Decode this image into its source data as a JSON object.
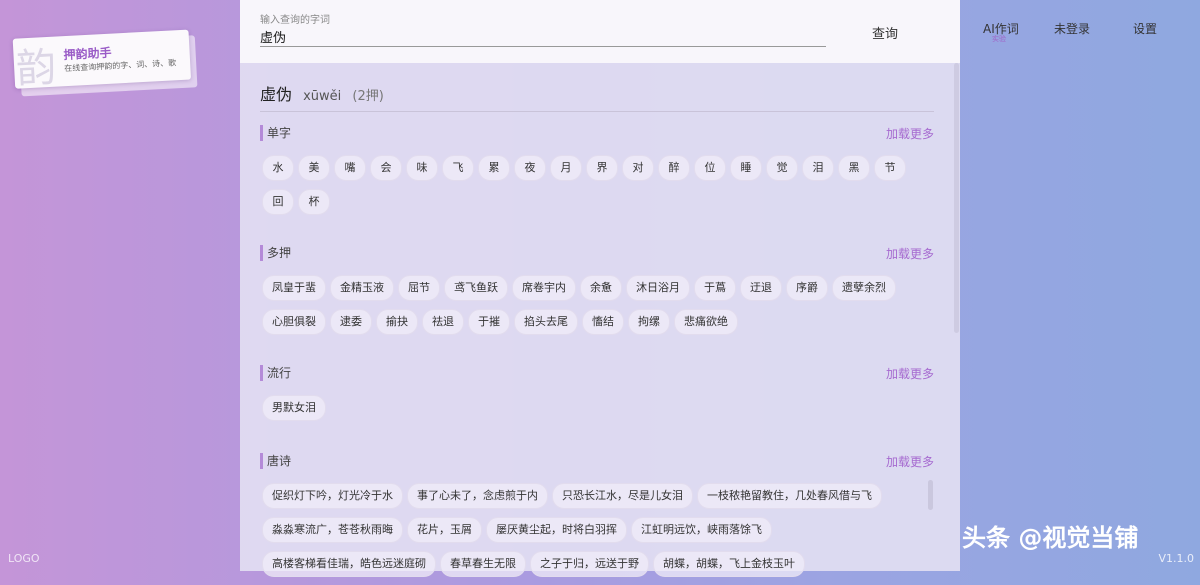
{
  "app": {
    "logo_glyph": "韵",
    "title": "押韵助手",
    "subtitle": "在线查询押韵的字、词、诗、歌",
    "bottom_logo": "LOGO",
    "version": "V1.1.0"
  },
  "search": {
    "label": "输入查询的字词",
    "value": "虚伪",
    "button": "查询"
  },
  "nav": {
    "ai": "AI作词",
    "ai_badge": "实验",
    "login": "未登录",
    "settings": "设置"
  },
  "result": {
    "word": "虚伪",
    "pinyin": "xūwěi",
    "count": "(2押)"
  },
  "sections": {
    "single": {
      "title": "单字",
      "more": "加载更多",
      "items": [
        "水",
        "美",
        "嘴",
        "会",
        "味",
        "飞",
        "累",
        "夜",
        "月",
        "界",
        "对",
        "醉",
        "位",
        "睡",
        "觉",
        "泪",
        "黑",
        "节",
        "回",
        "杯"
      ]
    },
    "multi": {
      "title": "多押",
      "more": "加载更多",
      "items": [
        "凤皇于蜚",
        "金精玉液",
        "屈节",
        "鸢飞鱼跃",
        "席卷宇内",
        "余惫",
        "沐日浴月",
        "于蔦",
        "迂退",
        "序爵",
        "遗孽余烈",
        "心胆俱裂",
        "逮委",
        "揄抉",
        "祛退",
        "于摧",
        "掐头去尾",
        "慉结",
        "拘缧",
        "悲痛欲绝"
      ]
    },
    "popular": {
      "title": "流行",
      "more": "加载更多",
      "items": [
        "男默女泪"
      ]
    },
    "tang": {
      "title": "唐诗",
      "more": "加载更多",
      "items": [
        "促织灯下吟，灯光冷于水",
        "事了心未了，念虑煎于内",
        "只恐长江水，尽是儿女泪",
        "一枝秾艳留教住，几处春风借与飞",
        "淼淼寒流广，苍苍秋雨晦",
        "花片，玉屑",
        "屡厌黄尘起，时将白羽挥",
        "江虹明远饮，峡雨落馀飞",
        "高楼客梯看佳瑞，皓色远迷庭砌",
        "春草春生无限",
        "之子于归，远送于野",
        "胡蝶，胡蝶，飞上金枝玉叶"
      ]
    }
  },
  "watermark": "头条 @视觉当铺"
}
